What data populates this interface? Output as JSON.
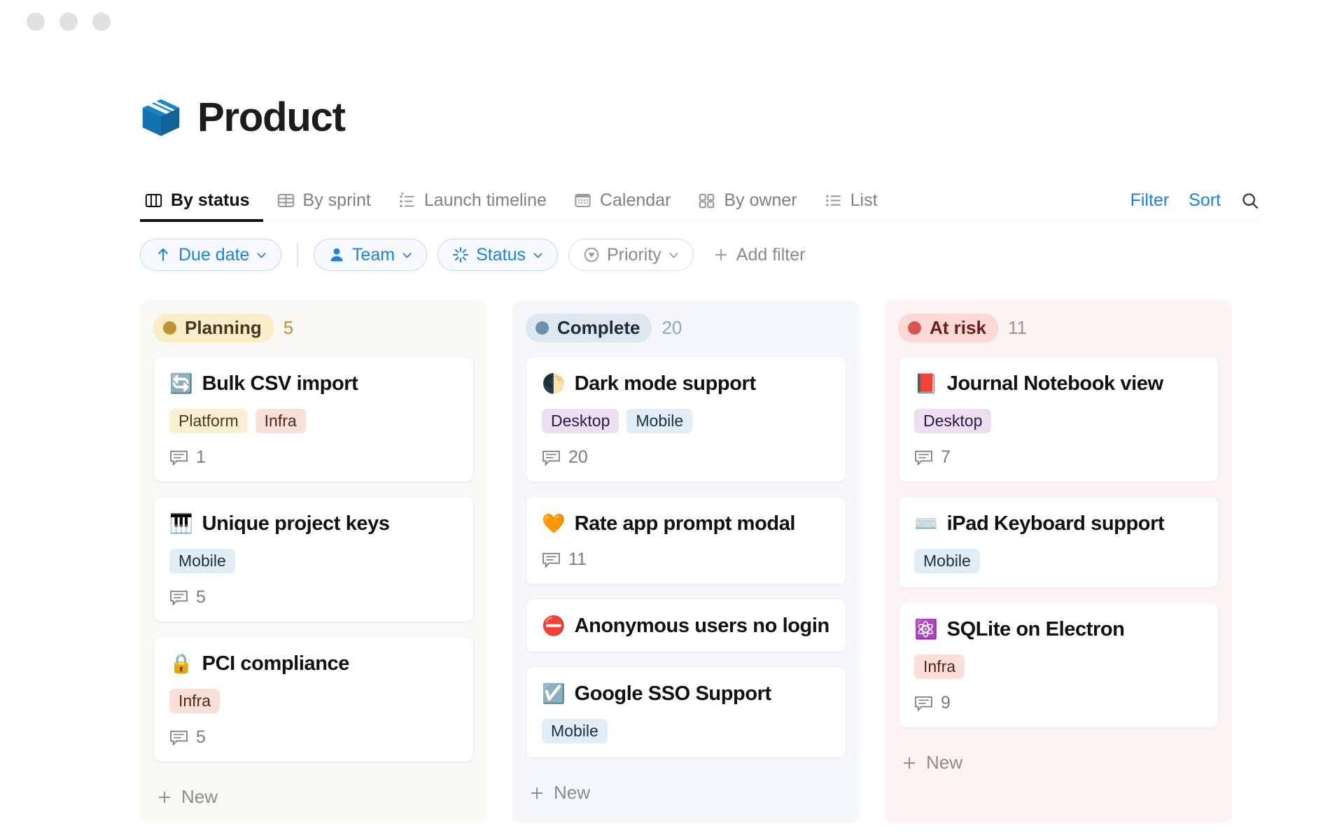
{
  "window": {
    "chrome_dots": 3
  },
  "header": {
    "title": "Product",
    "icon": "package-box-icon"
  },
  "tabs": [
    {
      "label": "By status",
      "icon": "board-columns-icon",
      "active": true
    },
    {
      "label": "By sprint",
      "icon": "table-grid-icon",
      "active": false
    },
    {
      "label": "Launch timeline",
      "icon": "timeline-icon",
      "active": false
    },
    {
      "label": "Calendar",
      "icon": "calendar-icon",
      "active": false
    },
    {
      "label": "By owner",
      "icon": "grid-squares-icon",
      "active": false
    },
    {
      "label": "List",
      "icon": "list-icon",
      "active": false
    }
  ],
  "toolbar": {
    "filter_label": "Filter",
    "sort_label": "Sort",
    "search_icon": "search-icon",
    "accent_color": "#1a82e2"
  },
  "filters": {
    "sort_chip": {
      "label": "Due date",
      "icon": "arrow-up-icon",
      "active": true
    },
    "chips": [
      {
        "label": "Team",
        "icon": "person-icon",
        "active": true
      },
      {
        "label": "Status",
        "icon": "sparkle-icon",
        "active": true
      },
      {
        "label": "Priority",
        "icon": "priority-circle-icon",
        "active": false
      }
    ],
    "add_filter_label": "Add filter"
  },
  "board": {
    "columns": [
      {
        "name": "Planning",
        "count": "5",
        "dot_color": "#c09433",
        "new_label": "New",
        "cards": [
          {
            "emoji": "🔄",
            "emoji_name": "arrows-counterclockwise-icon",
            "title": "Bulk CSV import",
            "tags": [
              {
                "label": "Platform",
                "style": "platform"
              },
              {
                "label": "Infra",
                "style": "infra"
              }
            ],
            "comments": "1"
          },
          {
            "emoji": "🎹",
            "emoji_name": "musical-keyboard-icon",
            "title": "Unique project keys",
            "tags": [
              {
                "label": "Mobile",
                "style": "mobile"
              }
            ],
            "comments": "5"
          },
          {
            "emoji": "🔒",
            "emoji_name": "lock-icon",
            "title": "PCI compliance",
            "tags": [
              {
                "label": "Infra",
                "style": "infra"
              }
            ],
            "comments": "5"
          }
        ]
      },
      {
        "name": "Complete",
        "count": "20",
        "dot_color": "#6d90ae",
        "new_label": "New",
        "cards": [
          {
            "emoji": "🌓",
            "emoji_name": "waning-crescent-moon-icon",
            "title": "Dark mode support",
            "tags": [
              {
                "label": "Desktop",
                "style": "desktop"
              },
              {
                "label": "Mobile",
                "style": "mobile"
              }
            ],
            "comments": "20"
          },
          {
            "emoji": "🧡",
            "emoji_name": "orange-heart-icon",
            "title": "Rate app prompt modal",
            "tags": [],
            "comments": "11"
          },
          {
            "emoji": "⛔",
            "emoji_name": "no-entry-icon",
            "title": "Anonymous users no login",
            "tags": [],
            "comments": ""
          },
          {
            "emoji": "☑️",
            "emoji_name": "ballot-box-check-icon",
            "title": "Google SSO Support",
            "tags": [
              {
                "label": "Mobile",
                "style": "mobile"
              }
            ],
            "comments": ""
          }
        ]
      },
      {
        "name": "At risk",
        "count": "11",
        "dot_color": "#d9544f",
        "new_label": "New",
        "cards": [
          {
            "emoji": "📕",
            "emoji_name": "closed-book-icon",
            "title": "Journal Notebook view",
            "tags": [
              {
                "label": "Desktop",
                "style": "desktop"
              }
            ],
            "comments": "7"
          },
          {
            "emoji": "⌨️",
            "emoji_name": "keyboard-icon",
            "title": "iPad Keyboard support",
            "tags": [
              {
                "label": "Mobile",
                "style": "mobile"
              }
            ],
            "comments": ""
          },
          {
            "emoji": "⚛️",
            "emoji_name": "atom-symbol-icon",
            "title": "SQLite on Electron",
            "tags": [
              {
                "label": "Infra",
                "style": "infra"
              }
            ],
            "comments": "9"
          }
        ]
      }
    ]
  }
}
